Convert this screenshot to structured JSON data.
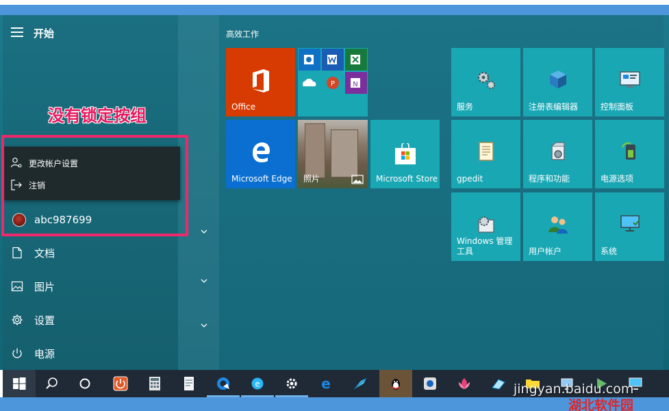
{
  "start": {
    "title": "开始"
  },
  "annotation": {
    "text": "没有锁定按组"
  },
  "account_menu": {
    "items": [
      {
        "label": "更改帐户设置",
        "icon": "account-settings-icon"
      },
      {
        "label": "注销",
        "icon": "sign-out-icon"
      }
    ]
  },
  "user": {
    "name": "abc987699"
  },
  "nav": {
    "items": [
      {
        "label": "文档",
        "icon": "document-icon"
      },
      {
        "label": "图片",
        "icon": "picture-icon"
      },
      {
        "label": "设置",
        "icon": "gear-icon"
      },
      {
        "label": "电源",
        "icon": "power-icon"
      }
    ]
  },
  "tiles": {
    "group_title": "高效工作",
    "office": "Office",
    "edge": "Microsoft Edge",
    "photos": "照片",
    "store": "Microsoft Store",
    "services": "服务",
    "regedit": "注册表编辑器",
    "control_panel": "控制面板",
    "gpedit": "gpedit",
    "programs": "程序和功能",
    "power_options": "电源选项",
    "admin_tools": "Windows 管理工具",
    "user_accounts": "用户帐户",
    "system": "系统"
  },
  "watermark": {
    "line1": "jingyan.baidu.com",
    "line2": "湖北软件园"
  },
  "colors": {
    "accent": "#1aa7b4",
    "office": "#d83b01",
    "edge_tile": "#0a6fd1",
    "annotation": "#e8175d",
    "taskbar": "#1f2a36"
  }
}
